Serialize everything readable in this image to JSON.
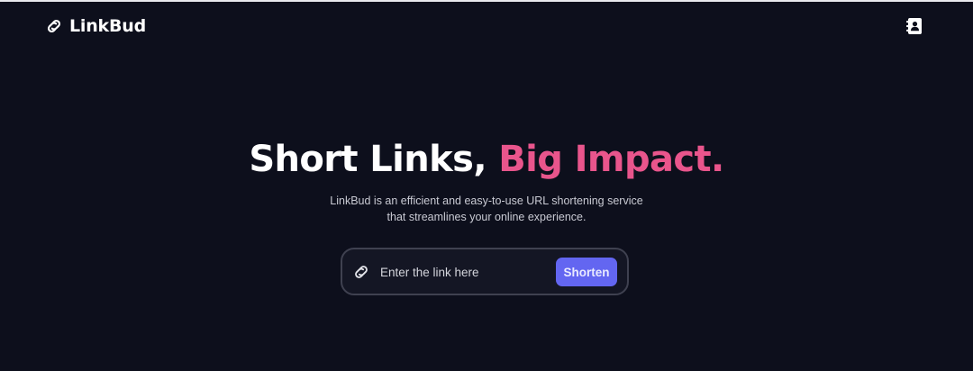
{
  "header": {
    "brand": {
      "name": "LinkBud",
      "icon": "link-icon"
    },
    "actions": {
      "contacts_icon": "address-book-icon"
    }
  },
  "hero": {
    "title_main": "Short Links, ",
    "title_accent": "Big Impact.",
    "description_line1": "LinkBud is an efficient and easy-to-use URL shortening service",
    "description_line2": "that streamlines your online experience."
  },
  "shortener": {
    "input_icon": "link-icon",
    "input_value": "",
    "input_placeholder": "Enter the link here",
    "button_label": "Shorten"
  },
  "colors": {
    "background": "#0d0f1c",
    "accent": "#e9558c",
    "button": "#6366f1",
    "input_border": "#3f4150",
    "text_primary": "#ffffff",
    "text_secondary": "#c9cad3"
  }
}
